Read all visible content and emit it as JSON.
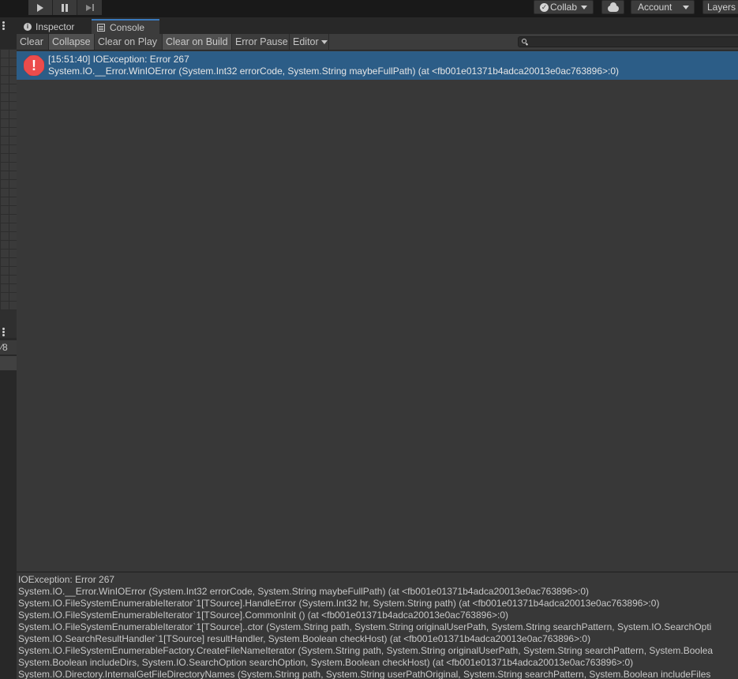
{
  "toolbar": {
    "collab_label": "Collab",
    "account_label": "Account",
    "layers_label": "Layers"
  },
  "tabs": [
    {
      "label": "Inspector",
      "icon": "info-icon"
    },
    {
      "label": "Console",
      "icon": "console-icon",
      "active": true
    }
  ],
  "console_toolbar": {
    "clear": "Clear",
    "collapse": "Collapse",
    "clear_on_play": "Clear on Play",
    "clear_on_build": "Clear on Build",
    "error_pause": "Error Pause",
    "editor": "Editor",
    "search_placeholder": ""
  },
  "log": {
    "selected_entry": {
      "line1": "[15:51:40] IOException: Error 267",
      "line2": "System.IO.__Error.WinIOError (System.Int32 errorCode, System.String maybeFullPath) (at <fb001e01371b4adca20013e0ac763896>:0)",
      "level": "error"
    }
  },
  "detail": {
    "lines": [
      "IOException: Error 267",
      "System.IO.__Error.WinIOError (System.Int32 errorCode, System.String maybeFullPath) (at <fb001e01371b4adca20013e0ac763896>:0)",
      "System.IO.FileSystemEnumerableIterator`1[TSource].HandleError (System.Int32 hr, System.String path) (at <fb001e01371b4adca20013e0ac763896>:0)",
      "System.IO.FileSystemEnumerableIterator`1[TSource].CommonInit () (at <fb001e01371b4adca20013e0ac763896>:0)",
      "System.IO.FileSystemEnumerableIterator`1[TSource]..ctor (System.String path, System.String originalUserPath, System.String searchPattern, System.IO.SearchOpti",
      "System.IO.SearchResultHandler`1[TSource] resultHandler, System.Boolean checkHost) (at <fb001e01371b4adca20013e0ac763896>:0)",
      "System.IO.FileSystemEnumerableFactory.CreateFileNameIterator (System.String path, System.String originalUserPath, System.String searchPattern, System.Boolea",
      "System.Boolean includeDirs, System.IO.SearchOption searchOption, System.Boolean checkHost) (at <fb001e01371b4adca20013e0ac763896>:0)",
      "System.IO.Directory.InternalGetFileDirectoryNames (System.String path, System.String userPathOriginal, System.String searchPattern, System.Boolean includeFiles"
    ]
  },
  "left_strip": {
    "label": "⁄8"
  }
}
